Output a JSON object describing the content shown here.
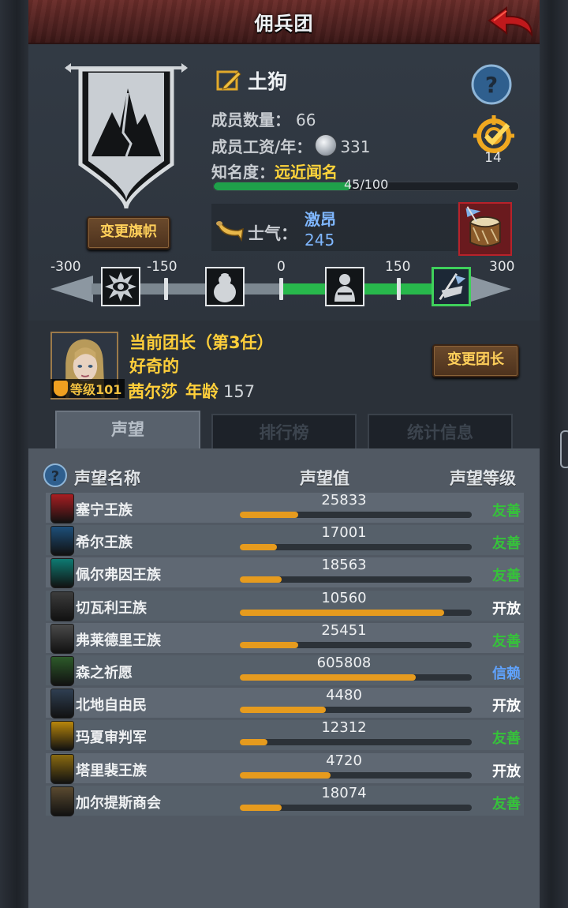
{
  "header": {
    "title": "佣兵团"
  },
  "guild": {
    "name": "土狗",
    "members_label": "成员数量：",
    "members_value": "66",
    "wage_label": "成员工资/年：",
    "wage_value": "331",
    "fame_label": "知名度：",
    "fame_rank": "远近闻名",
    "fame_progress": "45/100",
    "fame_fraction": 0.45,
    "quest_count": "14",
    "change_flag_label": "变更旗帜"
  },
  "morale": {
    "label": "士气：",
    "state": "激昂",
    "value": "245",
    "scale_labels": [
      "-300",
      "-150",
      "0",
      "150",
      "300"
    ]
  },
  "leader": {
    "title": "当前团长（第3任）",
    "trait": "好奇的",
    "name": "茜尔莎",
    "age_label": "年龄",
    "age": "157",
    "level": "等级101",
    "change_label": "变更团长"
  },
  "tabs": [
    {
      "label": "声望",
      "active": true
    },
    {
      "label": "排行榜",
      "active": false
    },
    {
      "label": "统计信息",
      "active": false
    }
  ],
  "table": {
    "headers": {
      "name": "声望名称",
      "value": "声望值",
      "level": "声望等级"
    },
    "rows": [
      {
        "name": "塞宁王族",
        "value": "25833",
        "fill": 0.25,
        "level": "友善",
        "level_color": "#36c23a",
        "icon_color": "#a81e22",
        "icon": "dragon-crest-icon"
      },
      {
        "name": "希尔王族",
        "value": "17001",
        "fill": 0.16,
        "level": "友善",
        "level_color": "#36c23a",
        "icon_color": "#1d4f7a",
        "icon": "helm-crest-icon"
      },
      {
        "name": "佩尔弗因王族",
        "value": "18563",
        "fill": 0.18,
        "level": "友善",
        "level_color": "#36c23a",
        "icon_color": "#0e7a72",
        "icon": "wave-crest-icon"
      },
      {
        "name": "切瓦利王族",
        "value": "10560",
        "fill": 0.88,
        "level": "开放",
        "level_color": "#ffffff",
        "icon_color": "#3c3c3c",
        "icon": "castle-crest-icon"
      },
      {
        "name": "弗莱德里王族",
        "value": "25451",
        "fill": 0.25,
        "level": "友善",
        "level_color": "#36c23a",
        "icon_color": "#4a4a4a",
        "icon": "skull-crest-icon"
      },
      {
        "name": "森之祈愿",
        "value": "605808",
        "fill": 0.76,
        "level": "信赖",
        "level_color": "#5fa3ff",
        "icon_color": "#2d5a2a",
        "icon": "tree-crest-icon"
      },
      {
        "name": "北地自由民",
        "value": "4480",
        "fill": 0.37,
        "level": "开放",
        "level_color": "#ffffff",
        "icon_color": "#2f3f52",
        "icon": "bear-crest-icon"
      },
      {
        "name": "玛夏审判军",
        "value": "12312",
        "fill": 0.12,
        "level": "友善",
        "level_color": "#36c23a",
        "icon_color": "#b8860b",
        "icon": "sun-crest-icon"
      },
      {
        "name": "塔里裴王族",
        "value": "4720",
        "fill": 0.39,
        "level": "开放",
        "level_color": "#ffffff",
        "icon_color": "#8a6a10",
        "icon": "crown-crest-icon"
      },
      {
        "name": "加尔提斯商会",
        "value": "18074",
        "fill": 0.18,
        "level": "友善",
        "level_color": "#36c23a",
        "icon_color": "#5a4a30",
        "icon": "chest-crest-icon"
      }
    ]
  }
}
